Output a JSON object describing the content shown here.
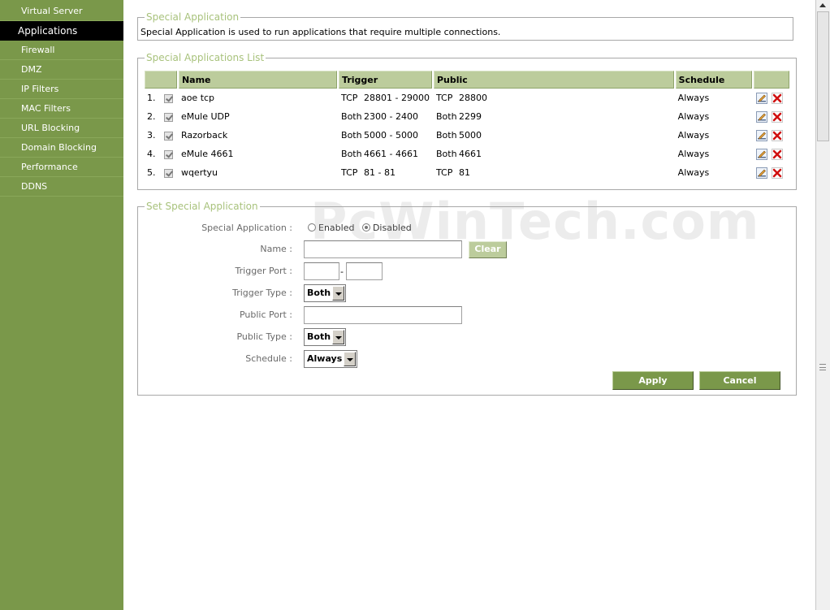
{
  "sidebar": {
    "items": [
      {
        "label": "Virtual Server"
      },
      {
        "label": "Applications",
        "active": true
      },
      {
        "label": "Firewall"
      },
      {
        "label": "DMZ"
      },
      {
        "label": "IP Filters"
      },
      {
        "label": "MAC Filters"
      },
      {
        "label": "URL Blocking"
      },
      {
        "label": "Domain Blocking"
      },
      {
        "label": "Performance"
      },
      {
        "label": "DDNS"
      }
    ]
  },
  "intro": {
    "legend": "Special Application",
    "description": "Special Application is used to run applications that require multiple connections."
  },
  "list": {
    "legend": "Special Applications List",
    "headers": {
      "name": "Name",
      "trigger": "Trigger",
      "public": "Public",
      "schedule": "Schedule"
    },
    "rows": [
      {
        "index": "1.",
        "name": "aoe tcp",
        "trigger_type": "TCP",
        "trigger_range": "28801 - 29000",
        "public_type": "TCP",
        "public_port": "28800",
        "schedule": "Always"
      },
      {
        "index": "2.",
        "name": "eMule UDP",
        "trigger_type": "Both",
        "trigger_range": "2300 - 2400",
        "public_type": "Both",
        "public_port": "2299",
        "schedule": "Always"
      },
      {
        "index": "3.",
        "name": "Razorback",
        "trigger_type": "Both",
        "trigger_range": "5000 - 5000",
        "public_type": "Both",
        "public_port": "5000",
        "schedule": "Always"
      },
      {
        "index": "4.",
        "name": "eMule 4661",
        "trigger_type": "Both",
        "trigger_range": "4661 - 4661",
        "public_type": "Both",
        "public_port": "4661",
        "schedule": "Always"
      },
      {
        "index": "5.",
        "name": "wqertyu",
        "trigger_type": "TCP",
        "trigger_range": "81 - 81",
        "public_type": "TCP",
        "public_port": "81",
        "schedule": "Always"
      }
    ]
  },
  "form": {
    "legend": "Set Special Application",
    "special_application_label": "Special Application :",
    "enabled_label": "Enabled",
    "disabled_label": "Disabled",
    "selected_state": "Disabled",
    "name_label": "Name :",
    "name_value": "",
    "clear_label": "Clear",
    "trigger_port_label": "Trigger Port :",
    "trigger_port_start": "",
    "trigger_port_end": "",
    "trigger_port_separator": "-",
    "trigger_type_label": "Trigger Type :",
    "trigger_type_value": "Both",
    "public_port_label": "Public Port :",
    "public_port_value": "",
    "public_type_label": "Public Type :",
    "public_type_value": "Both",
    "schedule_label": "Schedule :",
    "schedule_value": "Always",
    "apply_label": "Apply",
    "cancel_label": "Cancel"
  },
  "watermark": "PcWinTech.com",
  "colors": {
    "sidebar_bg": "#7a984a",
    "active_item_bg": "#000000",
    "legend_text": "#a8c27c",
    "header_bg": "#bccc9c",
    "button_bg": "#7a984a",
    "delete_icon": "#d01010"
  },
  "icons": {
    "edit": "pencil-edit-icon",
    "delete": "red-x-delete-icon",
    "checkbox": "checked-checkbox-icon"
  }
}
